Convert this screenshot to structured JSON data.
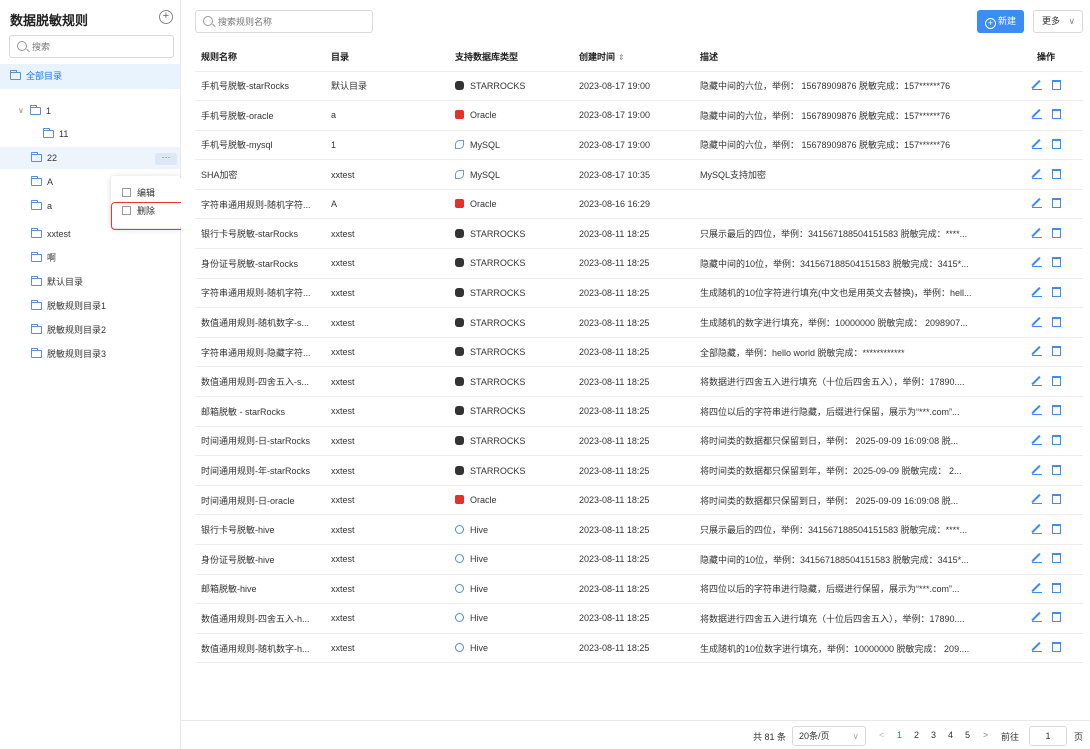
{
  "sidebar": {
    "title": "数据脱敏规则",
    "add_icon": "+",
    "search_placeholder": "搜索",
    "all_dir": "全部目录",
    "tree": [
      {
        "label": "1",
        "level": 0,
        "expanded": true
      },
      {
        "label": "11",
        "level": 1
      },
      {
        "label": "22",
        "level": 0,
        "selected": true
      },
      {
        "label": "A",
        "level": 0
      },
      {
        "label": "a",
        "level": 0
      },
      {
        "label": "xxtest",
        "level": 0
      },
      {
        "label": "啊",
        "level": 0
      },
      {
        "label": "默认目录",
        "level": 0
      },
      {
        "label": "脱敏规则目录1",
        "level": 0
      },
      {
        "label": "脱敏规则目录2",
        "level": 0
      },
      {
        "label": "脱敏规则目录3",
        "level": 0
      }
    ],
    "more_icon": "···",
    "context_menu": {
      "edit": "编辑",
      "delete": "删除"
    }
  },
  "toolbar": {
    "search_placeholder": "搜索规则名称",
    "new_label": "新建",
    "more_label": "更多",
    "more_caret": "∨"
  },
  "table": {
    "headers": [
      "规则名称",
      "目录",
      "支持数据库类型",
      "创建时间",
      "描述",
      "操作"
    ],
    "sort_icon": "⇕",
    "rows": [
      [
        "手机号脱敏-starRocks",
        "默认目录",
        "STARROCKS",
        "2023-08-17 19:00",
        "隐藏中间的六位，举例： 15678909876 脱敏完成：157******76"
      ],
      [
        "手机号脱敏-oracle",
        "a",
        "Oracle",
        "2023-08-17 19:00",
        "隐藏中间的六位，举例： 15678909876 脱敏完成：157******76"
      ],
      [
        "手机号脱敏-mysql",
        "1",
        "MySQL",
        "2023-08-17 19:00",
        "隐藏中间的六位，举例： 15678909876 脱敏完成：157******76"
      ],
      [
        "SHA加密",
        "xxtest",
        "MySQL",
        "2023-08-17 10:35",
        "MySQL支持加密"
      ],
      [
        "字符串通用规则-随机字符...",
        "A",
        "Oracle",
        "2023-08-16 16:29",
        ""
      ],
      [
        "银行卡号脱敏-starRocks",
        "xxtest",
        "STARROCKS",
        "2023-08-11 18:25",
        "只展示最后的四位，举例：341567188504151583 脱敏完成：****..."
      ],
      [
        "身份证号脱敏-starRocks",
        "xxtest",
        "STARROCKS",
        "2023-08-11 18:25",
        "隐藏中间的10位，举例：341567188504151583 脱敏完成：3415*..."
      ],
      [
        "字符串通用规则-随机字符...",
        "xxtest",
        "STARROCKS",
        "2023-08-11 18:25",
        "生成随机的10位字符进行填充(中文也是用英文去替换)，举例：hell..."
      ],
      [
        "数值通用规则-随机数字-s...",
        "xxtest",
        "STARROCKS",
        "2023-08-11 18:25",
        "生成随机的数字进行填充，举例：10000000 脱敏完成： 2098907..."
      ],
      [
        "字符串通用规则-隐藏字符...",
        "xxtest",
        "STARROCKS",
        "2023-08-11 18:25",
        "全部隐藏，举例：hello world 脱敏完成：************"
      ],
      [
        "数值通用规则-四舍五入-s...",
        "xxtest",
        "STARROCKS",
        "2023-08-11 18:25",
        "将数据进行四舍五入进行填充（十位后四舍五入），举例：17890...."
      ],
      [
        "邮箱脱敏 - starRocks",
        "xxtest",
        "STARROCKS",
        "2023-08-11 18:25",
        "将四位以后的字符串进行隐藏，后缀进行保留，展示为“***.com”..."
      ],
      [
        "时间通用规则-日-starRocks",
        "xxtest",
        "STARROCKS",
        "2023-08-11 18:25",
        "将时间类的数据都只保留到日，举例： 2025-09-09 16:09:08 脱..."
      ],
      [
        "时间通用规则-年-starRocks",
        "xxtest",
        "STARROCKS",
        "2023-08-11 18:25",
        "将时间类的数据都只保留到年，举例：2025-09-09 脱敏完成： 2..."
      ],
      [
        "时间通用规则-日-oracle",
        "xxtest",
        "Oracle",
        "2023-08-11 18:25",
        "将时间类的数据都只保留到日，举例： 2025-09-09 16:09:08 脱..."
      ],
      [
        "银行卡号脱敏-hive",
        "xxtest",
        "Hive",
        "2023-08-11 18:25",
        "只展示最后的四位，举例：341567188504151583 脱敏完成：****..."
      ],
      [
        "身份证号脱敏-hive",
        "xxtest",
        "Hive",
        "2023-08-11 18:25",
        "隐藏中间的10位，举例：341567188504151583 脱敏完成：3415*..."
      ],
      [
        "邮箱脱敏-hive",
        "xxtest",
        "Hive",
        "2023-08-11 18:25",
        "将四位以后的字符串进行隐藏，后缀进行保留，展示为“***.com”..."
      ],
      [
        "数值通用规则-四舍五入-h...",
        "xxtest",
        "Hive",
        "2023-08-11 18:25",
        "将数据进行四舍五入进行填充（十位后四舍五入），举例：17890...."
      ],
      [
        "数值通用规则-随机数字-h...",
        "xxtest",
        "Hive",
        "2023-08-11 18:25",
        "生成随机的10位数字进行填充，举例：10000000 脱敏完成： 209...."
      ]
    ]
  },
  "pagination": {
    "total": "共 81 条",
    "page_size": "20条/页",
    "page_size_caret": "∨",
    "prev": "<",
    "pages": [
      "1",
      "2",
      "3",
      "4",
      "5"
    ],
    "current_page": "1",
    "next": ">",
    "goto_label": "前往",
    "goto_value": "1",
    "page_unit": "页"
  },
  "colors": {
    "accent": "#3c8cf6",
    "highlight": "#e8f3fe",
    "danger": "#e8382f",
    "oracle": "#e5312a"
  }
}
